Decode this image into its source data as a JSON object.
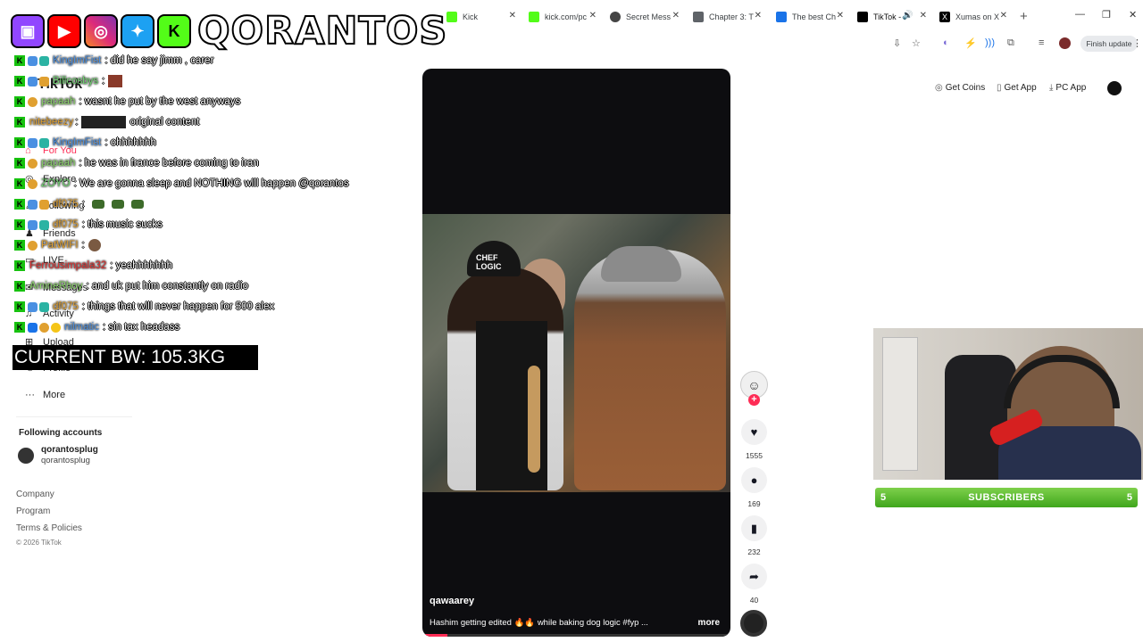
{
  "browser": {
    "tabs": [
      {
        "label": "Kick",
        "color": "#53fc18"
      },
      {
        "label": "kick.com/pc",
        "color": "#53fc18"
      },
      {
        "label": "Secret Mess",
        "color": "#444444"
      },
      {
        "label": "Chapter 3: T",
        "color": "#5f6368"
      },
      {
        "label": "The best Ch",
        "color": "#1a73e8"
      },
      {
        "label": "TikTok -",
        "color": "#000000"
      },
      {
        "label": "Xumas on X",
        "color": "#000000"
      }
    ],
    "finish_update": "Finish update"
  },
  "overlay": {
    "channel_name": "QORANTOS",
    "current_bw": "CURRENT BW: 105.3KG",
    "chat": [
      {
        "user": "KingImFist",
        "text": ": did he say jimm , carer",
        "color": "#4a90e2"
      },
      {
        "user": "Billcosbys",
        "text": ":",
        "color": "#6fd36f"
      },
      {
        "user": "papaah",
        "text": ": wasnt he put by the west anyways",
        "color": "#8bd66a"
      },
      {
        "user": "nitebeezy",
        "text": "original content",
        "color": "#e0a030"
      },
      {
        "user": "KingImFist",
        "text": ": ohhhhhhh",
        "color": "#4a90e2"
      },
      {
        "user": "papaah",
        "text": ": he was in france before coming to iran",
        "color": "#8bd66a"
      },
      {
        "user": "ZOYO",
        "text": ": We are gonna sleep and NOTHING will happen @qorantos",
        "color": "#6fd36f"
      },
      {
        "user": "df075",
        "text": ":",
        "color": "#e0a030"
      },
      {
        "user": "df075",
        "text": ": this music sucks",
        "color": "#e0a030"
      },
      {
        "user": "PatWIFI",
        "text": ":",
        "color": "#e0a030"
      },
      {
        "user": "Ferrousimpala32",
        "text": ": yeahhhhhhh",
        "color": "#e03030"
      },
      {
        "user": "AmineRhoy",
        "text": ": and uk put him constantly on radio",
        "color": "#8bd66a"
      },
      {
        "user": "df075",
        "text": ": things that will never happen for 500 alex",
        "color": "#e0a030"
      },
      {
        "user": "nilmatic",
        "text": ": sin tax headass",
        "color": "#4a90e2"
      }
    ],
    "subscribers_label": "SUBSCRIBERS",
    "subscribers_left": "5",
    "subscribers_right": "5"
  },
  "tiktok": {
    "logo": "TikTok",
    "nav": [
      {
        "label": "For You",
        "icon": "home-icon"
      },
      {
        "label": "Explore",
        "icon": "compass-icon"
      },
      {
        "label": "Following",
        "icon": "following-icon"
      },
      {
        "label": "Friends",
        "icon": "friends-icon"
      },
      {
        "label": "LIVE",
        "icon": "live-icon"
      },
      {
        "label": "Messages",
        "icon": "message-icon"
      },
      {
        "label": "Activity",
        "icon": "bell-icon"
      },
      {
        "label": "Upload",
        "icon": "plus-icon"
      },
      {
        "label": "Profile",
        "icon": "user-icon"
      },
      {
        "label": "More",
        "icon": "more-icon"
      }
    ],
    "following_head": "Following accounts",
    "account_name": "qorantosplug",
    "account_handle": "qorantosplug",
    "footer": [
      "Company",
      "Program",
      "Terms & Policies"
    ],
    "copyright": "© 2026 TikTok",
    "top_links": [
      "Get Coins",
      "Get App",
      "PC App"
    ],
    "video": {
      "author": "qawaarey",
      "caption": "Hashim getting edited 🔥🔥 while baking dog logic #fyp ...",
      "more": "more",
      "hat_text": "CHEF LOGIC",
      "progress": 0.08
    },
    "actions": {
      "likes": "1555",
      "comments": "169",
      "saves": "232",
      "shares": "40"
    }
  }
}
